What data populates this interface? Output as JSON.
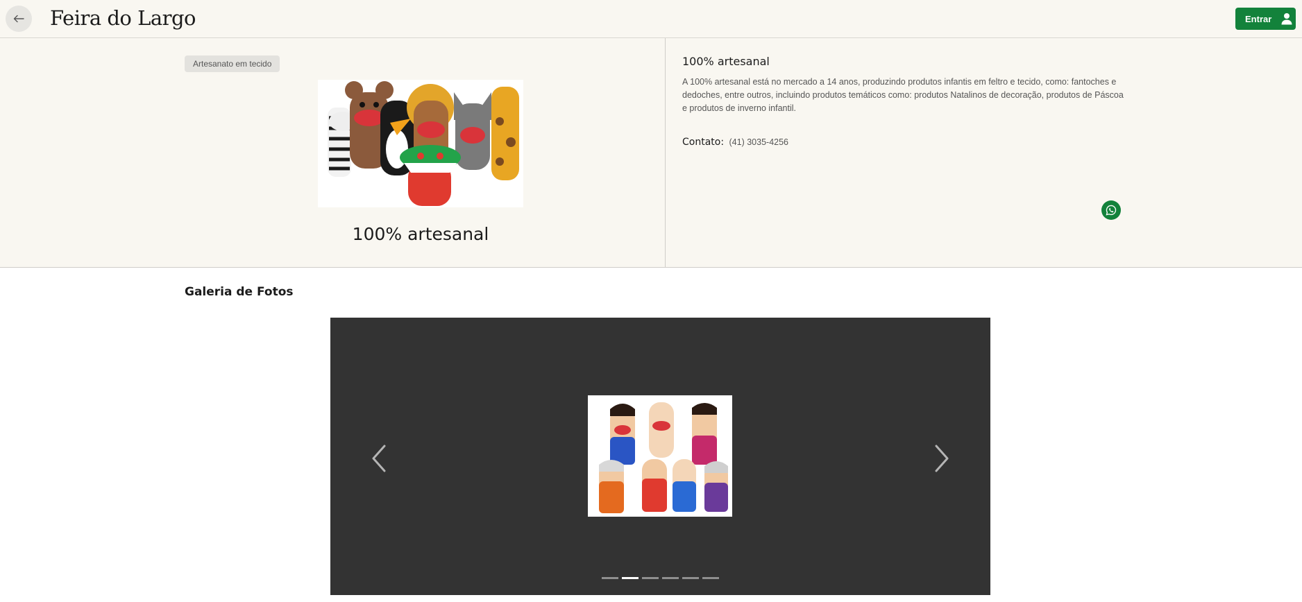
{
  "header": {
    "brand": "Feira do Largo",
    "login_label": "Entrar",
    "accent_color": "#13823b"
  },
  "vendor": {
    "category": "Artesanato em tecido",
    "name": "100% artesanal",
    "info_title": "100% artesanal",
    "description": "A 100% artesanal está no mercado a 14 anos, produzindo produtos infantis em feltro e tecido, como: fantoches e dedoches, entre outros, incluindo produtos temáticos como: produtos Natalinos de decoração, produtos de Páscoa e produtos de inverno infantil.",
    "contact_label": "Contato:",
    "contact_phone": "(41) 3035-4256"
  },
  "gallery": {
    "title": "Galeria de Fotos",
    "slide_count": 6,
    "active_index": 1
  },
  "icons": {
    "back": "arrow-left-icon",
    "user": "user-icon",
    "whatsapp": "whatsapp-icon",
    "prev": "chevron-left-icon",
    "next": "chevron-right-icon"
  }
}
